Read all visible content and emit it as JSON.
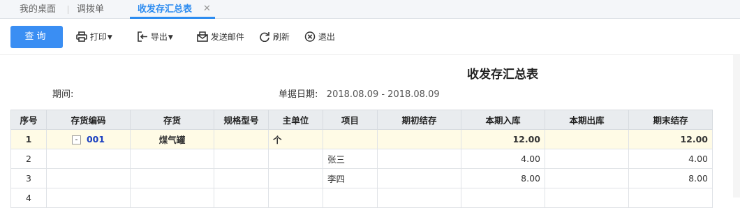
{
  "tabs": [
    {
      "label": "我的桌面"
    },
    {
      "label": "调拨单"
    },
    {
      "label": "收发存汇总表",
      "close": "✕"
    }
  ],
  "toolbar": {
    "query": "查询",
    "print": "打印",
    "export": "导出",
    "email": "发送邮件",
    "refresh": "刷新",
    "exit": "退出"
  },
  "report": {
    "title": "收发存汇总表",
    "period_label": "期间:",
    "date_label": "单据日期:",
    "date_value": "2018.08.09 - 2018.08.09"
  },
  "table": {
    "headers": [
      "序号",
      "存货编码",
      "存货",
      "规格型号",
      "主单位",
      "项目",
      "期初结存",
      "本期入库",
      "本期出库",
      "期末结存"
    ],
    "rows": [
      {
        "seq": "1",
        "code": "001",
        "collapse": "-",
        "item": "煤气罐",
        "spec": "",
        "unit": "个",
        "project": "",
        "opening": "",
        "in": "12.00",
        "out": "",
        "closing": "12.00"
      },
      {
        "seq": "2",
        "code": "",
        "item": "",
        "spec": "",
        "unit": "",
        "project": "张三",
        "opening": "",
        "in": "4.00",
        "out": "",
        "closing": "4.00"
      },
      {
        "seq": "3",
        "code": "",
        "item": "",
        "spec": "",
        "unit": "",
        "project": "李四",
        "opening": "",
        "in": "8.00",
        "out": "",
        "closing": "8.00"
      },
      {
        "seq": "4",
        "code": "",
        "item": "",
        "spec": "",
        "unit": "",
        "project": "",
        "opening": "",
        "in": "",
        "out": "",
        "closing": ""
      }
    ]
  }
}
